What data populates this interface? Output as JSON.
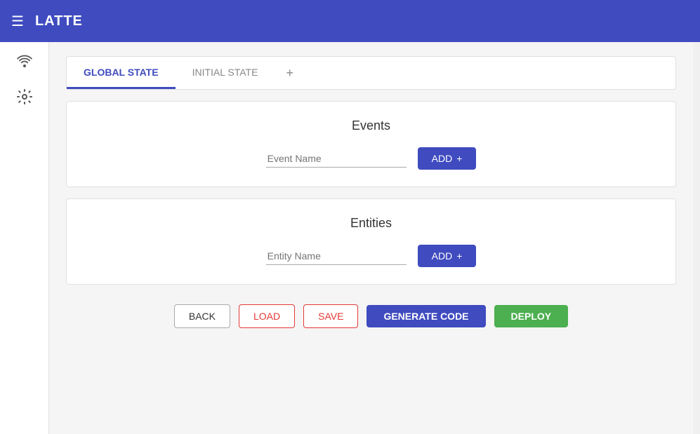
{
  "header": {
    "title": "LATTE",
    "menu_icon": "☰"
  },
  "sidebar": {
    "wifi_icon": "wifi",
    "gear_icon": "gear"
  },
  "tabs": {
    "items": [
      {
        "label": "GLOBAL STATE",
        "active": true
      },
      {
        "label": "INITIAL STATE",
        "active": false
      }
    ],
    "plus_label": "+"
  },
  "events_card": {
    "title": "Events",
    "input_placeholder": "Event Name",
    "add_label": "ADD",
    "add_icon": "+"
  },
  "entities_card": {
    "title": "Entities",
    "input_placeholder": "Entity Name",
    "add_label": "ADD",
    "add_icon": "+"
  },
  "toolbar": {
    "back_label": "BACK",
    "load_label": "LOAD",
    "save_label": "SAVE",
    "generate_label": "GENERATE CODE",
    "deploy_label": "DEPLOY"
  }
}
